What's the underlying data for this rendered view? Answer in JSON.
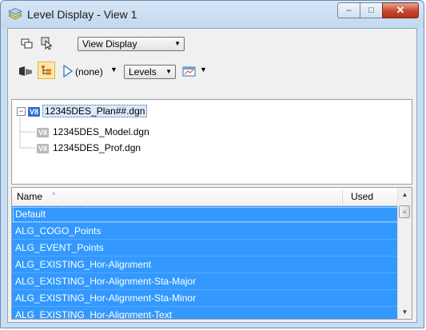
{
  "window": {
    "title": "Level Display - View 1",
    "title_icon": "level-display-icon",
    "caption": {
      "minimize": "–",
      "maximize": "□",
      "close": "✕"
    }
  },
  "toolbar1": {
    "icons": [
      "view-windows-icon",
      "select-element-icon"
    ],
    "view_combo": "View Display"
  },
  "toolbar2": {
    "icons": [
      "level-filter-icon",
      "tree-view-icon",
      "filter-icon"
    ],
    "filter_value": "(none)",
    "levels_combo": "Levels",
    "manager_icon": "level-manager-icon"
  },
  "tree": {
    "root": {
      "label": "12345DES_Plan##.dgn",
      "badge": "V8",
      "expanded": true
    },
    "children": [
      {
        "label": "12345DES_Model.dgn",
        "badge": "V8"
      },
      {
        "label": "12345DES_Prof.dgn",
        "badge": "V8"
      }
    ]
  },
  "levels_list": {
    "columns": {
      "name": "Name",
      "used": "Used"
    },
    "rows": [
      "Default",
      "ALG_COGO_Points",
      "ALG_EVENT_Points",
      "ALG_EXISTING_Hor-Alignment",
      "ALG_EXISTING_Hor-Alignment-Sta-Major",
      "ALG_EXISTING_Hor-Alignment-Sta-Minor",
      "ALG_EXISTING_Hor-Alignment-Text"
    ]
  },
  "colors": {
    "selection": "#3399ff",
    "title_bar": "#c9ddf2",
    "close_button": "#c7462c"
  }
}
